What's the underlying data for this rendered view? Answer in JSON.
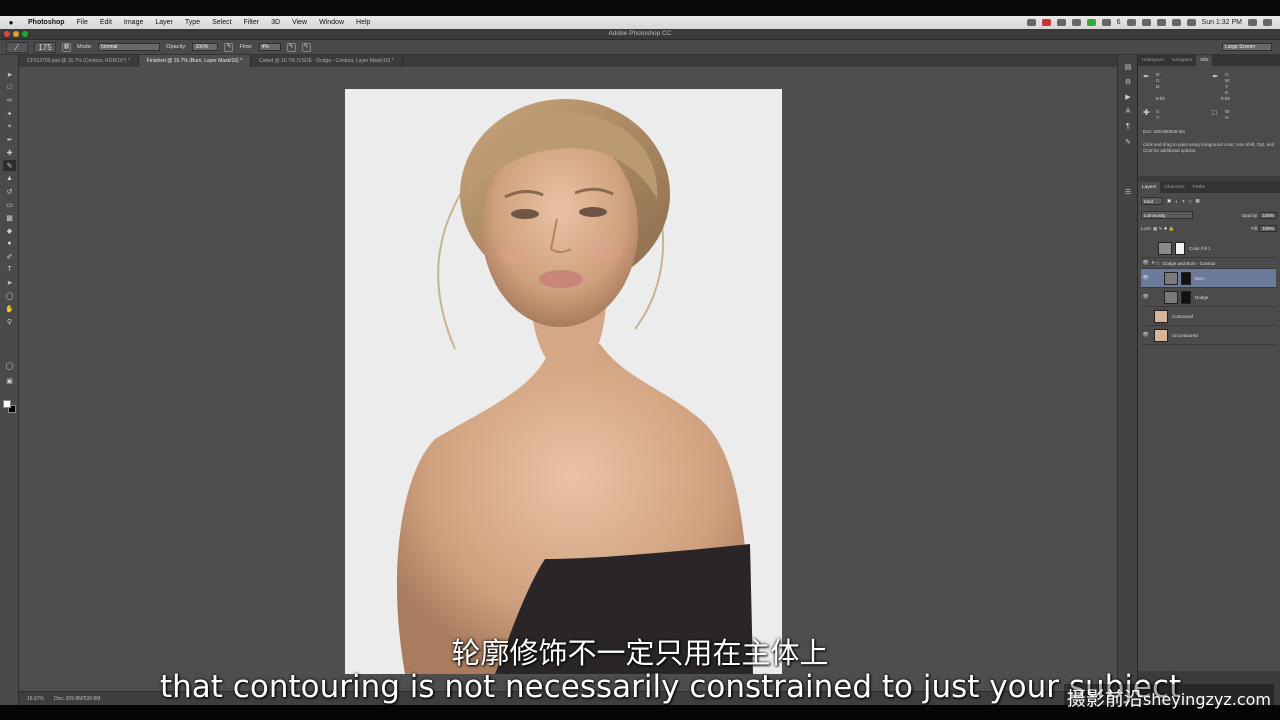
{
  "menubar": {
    "app": "Photoshop",
    "items": [
      "File",
      "Edit",
      "Image",
      "Layer",
      "Type",
      "Select",
      "Filter",
      "3D",
      "View",
      "Window",
      "Help"
    ],
    "clock": "Sun 1:32 PM",
    "badge": "6"
  },
  "window": {
    "title": "Adobe Photoshop CC"
  },
  "options": {
    "brush_size": "175",
    "mode_label": "Mode:",
    "mode_value": "Normal",
    "opacity_label": "Opacity:",
    "opacity_value": "100%",
    "flow_label": "Flow:",
    "flow_value": "4%",
    "workspace": "Large Screen"
  },
  "doc_tabs": [
    "CF012700.psd @ 16.7% (Contour, RGB/16*) *",
    "Finished @ 16.7% (Burn, Layer Mask/16) *",
    "Called @ 16.7% (VSDE - Dodge - Contour, Layer Mask/16) *"
  ],
  "statusbar": {
    "zoom": "16.67%",
    "doc": "Doc: 209.8M/538.8M"
  },
  "info_panel": {
    "tabs": [
      "Histogram",
      "Navigator",
      "Info"
    ],
    "r": "R:\nG:\nB:",
    "c": "C:\nM:\nY:\nK:",
    "bits_left": "8-bit",
    "bits_right": "8-bit",
    "x": "X:\nY:",
    "w": "W:\nH:",
    "doc": "Doc: 209.8M/538.8M",
    "hint": "Click and drag to paint using foreground color. Use Shift, Opt, and Cmd for additional options."
  },
  "layers_panel": {
    "tabs": [
      "Layers",
      "Channels",
      "Paths"
    ],
    "filter": "Kind",
    "blend": "Luminosity",
    "opacity_label": "Opacity:",
    "opacity_value": "100%",
    "lock_label": "Lock:",
    "fill_label": "Fill:",
    "fill_value": "100%",
    "layers": [
      {
        "name": "Color Fill 1"
      },
      {
        "name": "Dodge and Burn - Contour"
      },
      {
        "name": "Burn"
      },
      {
        "name": "Dodge"
      },
      {
        "name": "Contoured"
      },
      {
        "name": "Uncontoured"
      }
    ]
  },
  "subtitles": {
    "cn": "轮廓修饰不一定只用在主体上",
    "en": "that contouring is not necessarily constrained to just your subject",
    "watermark_cn": "摄影前沿",
    "watermark_en": "sheyingzyz.com"
  },
  "colors": {
    "selected_layer": "#6a7a98",
    "canvas_bg": "#4e4e4e",
    "photo_bg": "#ececec"
  }
}
